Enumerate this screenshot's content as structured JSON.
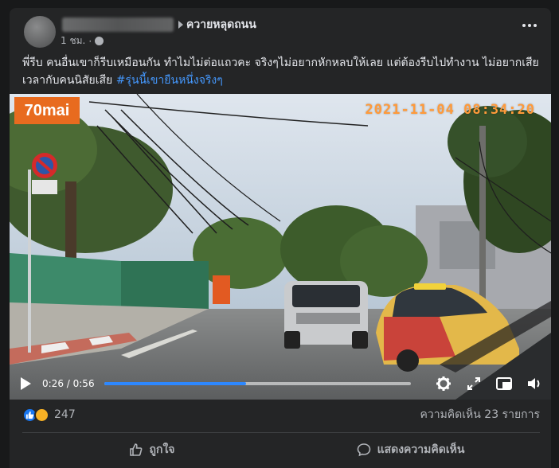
{
  "post": {
    "group_name": "ควายหลุดถนน",
    "time_label": "1 ชม.",
    "text": "พี่รีบ คนอื่นเขาก็รีบเหมือนกัน ทำไมไม่ต่อแถวคะ จริงๆไม่อยากหักหลบให้เลย แต่ต้องรีบไปทำงาน ไม่อยากเสียเวลากับคนนิสัยเสีย ",
    "hashtag": "#รุ่นนี้เขายืนหนึ่งจริงๆ"
  },
  "video": {
    "brand": "70mai",
    "timestamp": "2021-11-04 08:34:20",
    "current_time": "0:26",
    "duration": "0:56",
    "progress_fraction": 0.464,
    "time_separator": " / "
  },
  "stats": {
    "reaction_count": "247",
    "comments_label": "ความคิดเห็น 23 รายการ"
  },
  "actions": {
    "like_label": "ถูกใจ",
    "comment_label": "แสดงความคิดเห็น"
  },
  "colors": {
    "accent": "#2d88ff",
    "hashtag": "#4599ff",
    "brand_orange": "#e86b1f",
    "timestamp_orange": "#ff9a3a"
  },
  "icons": {
    "play": "play-icon",
    "settings": "gear-icon",
    "expand": "expand-icon",
    "pip": "picture-in-picture-icon",
    "volume": "volume-icon",
    "like": "thumbs-up-icon",
    "comment": "comment-icon",
    "more": "more-dots-icon",
    "privacy": "globe-icon"
  }
}
